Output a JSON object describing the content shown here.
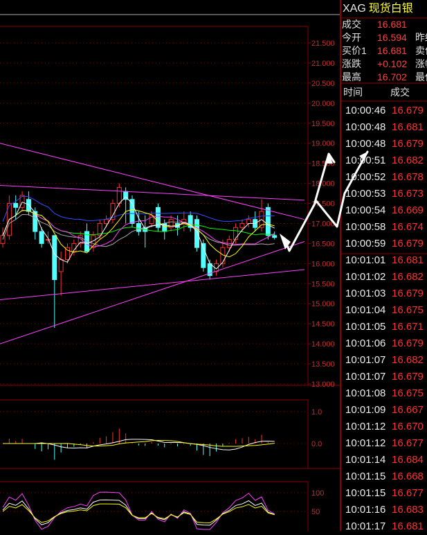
{
  "instrument": {
    "code": "XAG",
    "name": "现货白银"
  },
  "quote": [
    {
      "label": "成交",
      "value": "16.681",
      "label2": ""
    },
    {
      "label": "今开",
      "value": "16.594",
      "label2": "昨结"
    },
    {
      "label": "买价1",
      "value": "16.681",
      "label2": "卖价"
    },
    {
      "label": "涨跌",
      "value": "+0.102",
      "label2": "涨幅"
    },
    {
      "label": "最高",
      "value": "16.702",
      "label2": "最低"
    }
  ],
  "ticks_header": {
    "time": "时间",
    "price": "成交"
  },
  "ticks": [
    {
      "time": "10:00:46",
      "price": "16.679"
    },
    {
      "time": "10:00:48",
      "price": "16.681"
    },
    {
      "time": "10:00:48",
      "price": "16.679"
    },
    {
      "time": "10:00:51",
      "price": "16.682"
    },
    {
      "time": "10:00:52",
      "price": "16.678"
    },
    {
      "time": "10:00:53",
      "price": "16.673"
    },
    {
      "time": "10:00:54",
      "price": "16.669"
    },
    {
      "time": "10:00:58",
      "price": "16.674"
    },
    {
      "time": "10:00:59",
      "price": "16.679"
    },
    {
      "time": "10:01:01",
      "price": "16.681"
    },
    {
      "time": "10:01:02",
      "price": "16.682"
    },
    {
      "time": "10:01:03",
      "price": "16.679"
    },
    {
      "time": "10:01:04",
      "price": "16.675"
    },
    {
      "time": "10:01:05",
      "price": "16.671"
    },
    {
      "time": "10:01:06",
      "price": "16.679"
    },
    {
      "time": "10:01:07",
      "price": "16.682"
    },
    {
      "time": "10:01:07",
      "price": "16.679"
    },
    {
      "time": "10:01:08",
      "price": "16.675"
    },
    {
      "time": "10:01:09",
      "price": "16.667"
    },
    {
      "time": "10:01:12",
      "price": "16.670"
    },
    {
      "time": "10:01:12",
      "price": "16.677"
    },
    {
      "time": "10:01:14",
      "price": "16.684"
    },
    {
      "time": "10:01:15",
      "price": "16.668"
    },
    {
      "time": "10:01:15",
      "price": "16.677"
    },
    {
      "time": "10:01:16",
      "price": "16.683"
    },
    {
      "time": "10:01:17",
      "price": "16.681"
    }
  ],
  "main_axis": {
    "labels": [
      "21.500",
      "21.000",
      "20.500",
      "20.000",
      "19.500",
      "19.000",
      "18.500",
      "18.000",
      "17.500",
      "17.000",
      "16.500",
      "16.000",
      "15.500",
      "15.000",
      "14.500",
      "14.000",
      "13.500",
      "13.000"
    ],
    "max": 21.5,
    "min": 13.0
  },
  "macd_axis": {
    "labels": [
      "1.0",
      "0.0"
    ]
  },
  "kdj_axis": {
    "labels": [
      "100",
      "50"
    ]
  },
  "colors": {
    "grid": "#8b0000",
    "up": "#ff3030",
    "down": "#54ffff",
    "axis_text": "#c03030",
    "trend": "#ff40ff",
    "ma5": "#ffffff",
    "ma10": "#ffff00",
    "ma20": "#ff40ff",
    "ma30": "#00ff00",
    "ma60": "#3050ff",
    "ma_extra": "#aaaaaa"
  },
  "chart_data": {
    "type": "candlestick",
    "series": [
      {
        "o": 16.5,
        "h": 16.9,
        "c": 16.7,
        "l": 16.4
      },
      {
        "o": 16.7,
        "h": 17.7,
        "c": 17.5,
        "l": 16.6
      },
      {
        "o": 17.5,
        "h": 17.7,
        "c": 17.4,
        "l": 17.1
      },
      {
        "o": 17.4,
        "h": 17.8,
        "c": 17.7,
        "l": 17.3
      },
      {
        "o": 17.6,
        "h": 17.8,
        "c": 17.3,
        "l": 17.2
      },
      {
        "o": 17.3,
        "h": 17.4,
        "c": 16.8,
        "l": 16.6
      },
      {
        "o": 16.8,
        "h": 16.9,
        "c": 16.5,
        "l": 16.4
      },
      {
        "o": 16.6,
        "h": 16.8,
        "c": 16.6,
        "l": 16.5
      },
      {
        "o": 16.7,
        "h": 16.7,
        "c": 15.6,
        "l": 14.4
      },
      {
        "o": 15.8,
        "h": 16.3,
        "c": 16.1,
        "l": 15.2
      },
      {
        "o": 16.1,
        "h": 16.5,
        "c": 16.4,
        "l": 16.0
      },
      {
        "o": 16.3,
        "h": 16.6,
        "c": 16.5,
        "l": 16.2
      },
      {
        "o": 16.5,
        "h": 16.8,
        "c": 16.7,
        "l": 16.4
      },
      {
        "o": 16.8,
        "h": 17.0,
        "c": 16.3,
        "l": 16.3
      },
      {
        "o": 16.4,
        "h": 16.8,
        "c": 16.7,
        "l": 16.3
      },
      {
        "o": 16.7,
        "h": 17.1,
        "c": 17.0,
        "l": 16.6
      },
      {
        "o": 17.0,
        "h": 17.2,
        "c": 17.1,
        "l": 16.9
      },
      {
        "o": 17.1,
        "h": 17.6,
        "c": 17.5,
        "l": 17.0
      },
      {
        "o": 17.5,
        "h": 18.0,
        "c": 17.9,
        "l": 17.4
      },
      {
        "o": 17.8,
        "h": 17.9,
        "c": 17.6,
        "l": 17.0
      },
      {
        "o": 17.6,
        "h": 17.7,
        "c": 17.0,
        "l": 16.9
      },
      {
        "o": 17.0,
        "h": 17.3,
        "c": 16.8,
        "l": 16.7
      },
      {
        "o": 16.9,
        "h": 17.2,
        "c": 16.8,
        "l": 16.4
      },
      {
        "o": 17.0,
        "h": 17.3,
        "c": 17.2,
        "l": 16.9
      },
      {
        "o": 17.4,
        "h": 17.5,
        "c": 16.9,
        "l": 16.8
      },
      {
        "o": 17.0,
        "h": 17.1,
        "c": 16.8,
        "l": 16.6
      },
      {
        "o": 16.9,
        "h": 17.2,
        "c": 17.1,
        "l": 16.8
      },
      {
        "o": 17.0,
        "h": 17.2,
        "c": 16.9,
        "l": 16.7
      },
      {
        "o": 17.0,
        "h": 17.3,
        "c": 17.1,
        "l": 16.8
      },
      {
        "o": 17.2,
        "h": 17.3,
        "c": 16.9,
        "l": 16.8
      },
      {
        "o": 17.1,
        "h": 17.2,
        "c": 16.4,
        "l": 16.3
      },
      {
        "o": 16.5,
        "h": 16.6,
        "c": 15.9,
        "l": 15.8
      },
      {
        "o": 16.0,
        "h": 16.1,
        "c": 15.7,
        "l": 15.6
      },
      {
        "o": 15.8,
        "h": 16.1,
        "c": 16.0,
        "l": 15.7
      },
      {
        "o": 16.0,
        "h": 16.6,
        "c": 16.4,
        "l": 15.9
      },
      {
        "o": 16.4,
        "h": 16.7,
        "c": 16.6,
        "l": 16.3
      },
      {
        "o": 16.6,
        "h": 17.0,
        "c": 16.9,
        "l": 16.5
      },
      {
        "o": 16.9,
        "h": 17.1,
        "c": 17.0,
        "l": 16.8
      },
      {
        "o": 17.0,
        "h": 17.2,
        "c": 17.1,
        "l": 16.9
      },
      {
        "o": 17.1,
        "h": 17.3,
        "c": 16.9,
        "l": 16.8
      },
      {
        "o": 16.9,
        "h": 17.6,
        "c": 17.3,
        "l": 16.8
      },
      {
        "o": 17.4,
        "h": 17.5,
        "c": 16.7,
        "l": 16.6
      },
      {
        "o": 16.7,
        "h": 16.8,
        "c": 16.65,
        "l": 16.6
      }
    ],
    "ylim": [
      13.0,
      21.5
    ]
  }
}
